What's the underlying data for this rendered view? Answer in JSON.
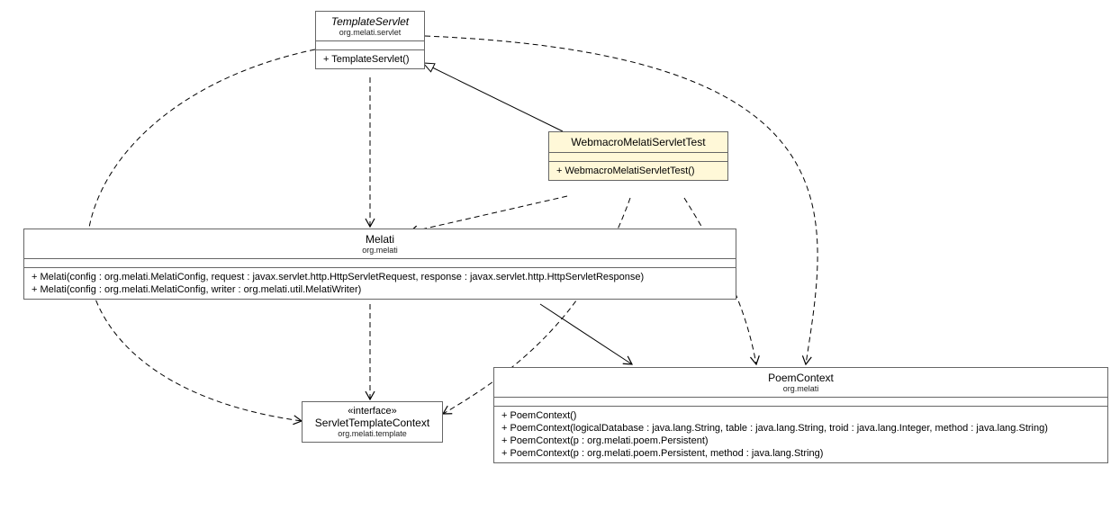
{
  "classes": {
    "templateServlet": {
      "name": "TemplateServlet",
      "package": "org.melati.servlet",
      "ops": [
        "+ TemplateServlet()"
      ]
    },
    "webmacro": {
      "name": "WebmacroMelatiServletTest",
      "ops": [
        "+ WebmacroMelatiServletTest()"
      ]
    },
    "melati": {
      "name": "Melati",
      "package": "org.melati",
      "ops": [
        "+ Melati(config : org.melati.MelatiConfig, request : javax.servlet.http.HttpServletRequest, response : javax.servlet.http.HttpServletResponse)",
        "+ Melati(config : org.melati.MelatiConfig, writer : org.melati.util.MelatiWriter)"
      ]
    },
    "servletTemplateContext": {
      "stereotype": "«interface»",
      "name": "ServletTemplateContext",
      "package": "org.melati.template"
    },
    "poemContext": {
      "name": "PoemContext",
      "package": "org.melati",
      "ops": [
        "+ PoemContext()",
        "+ PoemContext(logicalDatabase : java.lang.String, table : java.lang.String, troid : java.lang.Integer, method : java.lang.String)",
        "+ PoemContext(p : org.melati.poem.Persistent)",
        "+ PoemContext(p : org.melati.poem.Persistent, method : java.lang.String)"
      ]
    }
  }
}
